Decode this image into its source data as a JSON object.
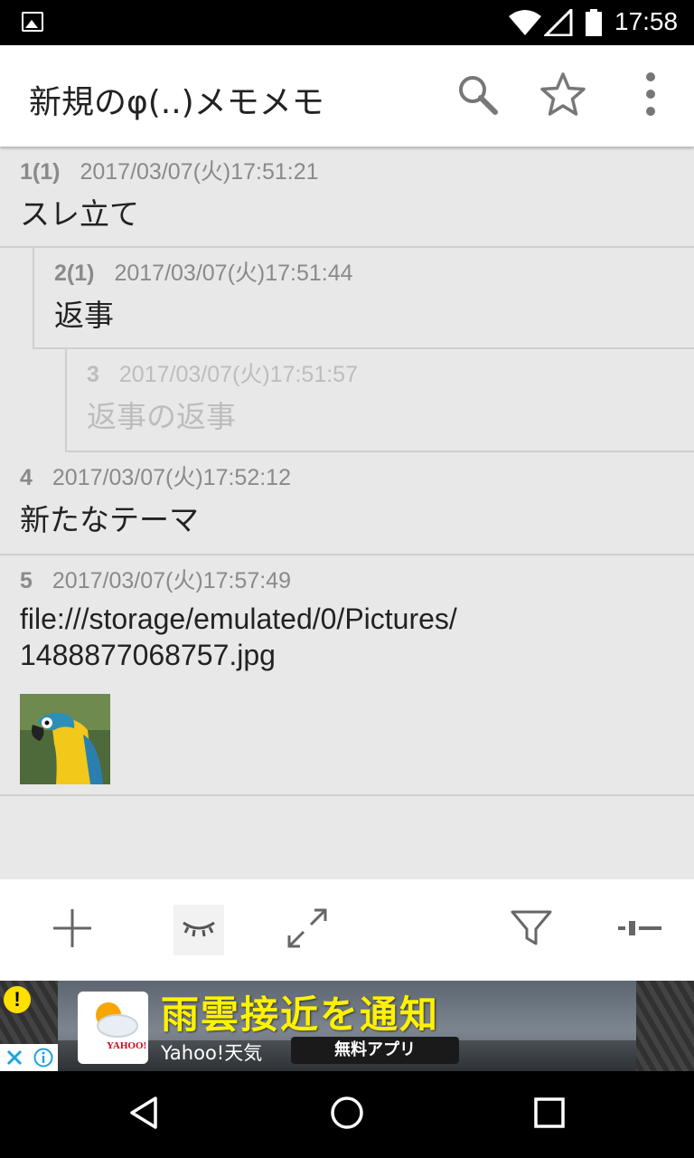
{
  "status_bar": {
    "time": "17:58",
    "icons": [
      "image-notification-icon",
      "wifi-icon",
      "signal-icon",
      "battery-icon"
    ]
  },
  "app_bar": {
    "title": "新規のφ(..)メモメモ",
    "actions": [
      "search-icon",
      "star-icon",
      "overflow-menu-icon"
    ]
  },
  "posts": [
    {
      "number": "1(1)",
      "timestamp": "2017/03/07(火)17:51:21",
      "body": "スレ立て",
      "depth": 0,
      "dimmed": false
    },
    {
      "number": "2(1)",
      "timestamp": "2017/03/07(火)17:51:44",
      "body": "返事",
      "depth": 1,
      "dimmed": false
    },
    {
      "number": "3",
      "timestamp": "2017/03/07(火)17:51:57",
      "body": "返事の返事",
      "depth": 2,
      "dimmed": true
    },
    {
      "number": "4",
      "timestamp": "2017/03/07(火)17:52:12",
      "body": "新たなテーマ",
      "depth": 0,
      "dimmed": false
    },
    {
      "number": "5",
      "timestamp": "2017/03/07(火)17:57:49",
      "body_line1": "file:///storage/emulated/0/Pictures/",
      "body_line2": "1488877068757.jpg",
      "depth": 0,
      "dimmed": false,
      "has_image": true,
      "image": "parrot-thumbnail"
    }
  ],
  "bottom_toolbar": {
    "items": [
      "add-icon",
      "hide-eye-icon",
      "expand-icon",
      "filter-icon",
      "collapse-icon"
    ]
  },
  "ad": {
    "headline": "雨雲接近を通知",
    "subtitle": "Yahoo!天気",
    "cta": "無料アプリ",
    "logo_text": "YAHOO!",
    "warning_mark": "!"
  },
  "nav_bar": {
    "items": [
      "back-icon",
      "home-icon",
      "recents-icon"
    ]
  },
  "colors": {
    "app_bar_bg": "#ffffff",
    "thread_bg": "#e8e8e8",
    "meta_text": "#8a8a8a",
    "dim_text": "#bdbdbd",
    "ad_headline": "#fff200"
  }
}
